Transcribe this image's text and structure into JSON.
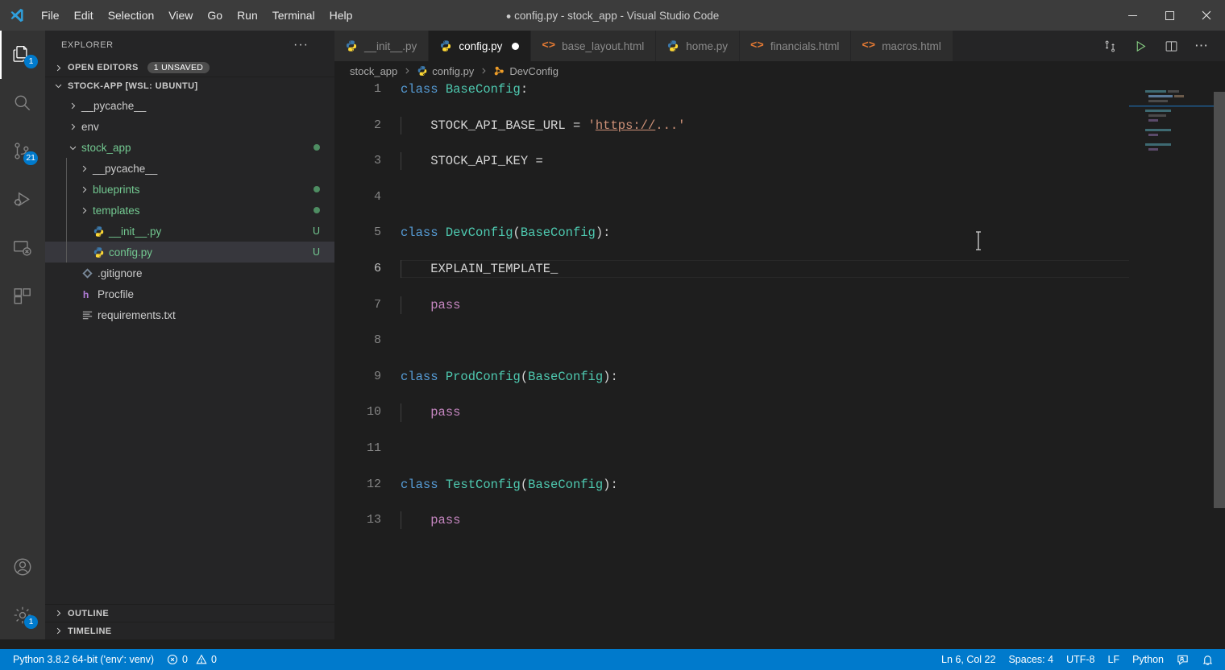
{
  "titlebar": {
    "menus": [
      "File",
      "Edit",
      "Selection",
      "View",
      "Go",
      "Run",
      "Terminal",
      "Help"
    ],
    "unsaved_dot": "●",
    "title": "config.py - stock_app - Visual Studio Code",
    "minimize": "─",
    "maximize": "☐",
    "close": "✕",
    "logo_name": "vscode-logo"
  },
  "activitybar": {
    "items": [
      {
        "name": "explorer",
        "icon": "files-icon",
        "badge": "1",
        "active": true
      },
      {
        "name": "search",
        "icon": "search-icon",
        "badge": "",
        "active": false
      },
      {
        "name": "source-control",
        "icon": "source-control-icon",
        "badge": "21",
        "active": false
      },
      {
        "name": "run-and-debug",
        "icon": "run-debug-icon",
        "badge": "",
        "active": false
      },
      {
        "name": "remote-explorer",
        "icon": "remote-icon",
        "badge": "",
        "active": false
      },
      {
        "name": "extensions",
        "icon": "extensions-icon",
        "badge": "",
        "active": false
      }
    ],
    "bottom": [
      {
        "name": "accounts",
        "icon": "account-icon",
        "badge": ""
      },
      {
        "name": "settings",
        "icon": "gear-icon",
        "badge": "1"
      }
    ]
  },
  "sidebar": {
    "title": "EXPLORER",
    "more_actions": "···",
    "open_editors": {
      "label": "OPEN EDITORS",
      "badge": "1 UNSAVED",
      "expanded": false
    },
    "workspace": {
      "label": "STOCK-APP [WSL: UBUNTU]",
      "expanded": true
    },
    "tree": [
      {
        "label": "__pycache__",
        "type": "folder",
        "depth": 1,
        "expanded": false,
        "color": "gray",
        "suffix": "",
        "suffix_type": "",
        "selected": false
      },
      {
        "label": "env",
        "type": "folder",
        "depth": 1,
        "expanded": false,
        "color": "gray",
        "suffix": "",
        "suffix_type": "",
        "selected": false
      },
      {
        "label": "stock_app",
        "type": "folder",
        "depth": 1,
        "expanded": true,
        "color": "green",
        "suffix": "",
        "suffix_type": "dot",
        "selected": false
      },
      {
        "label": "__pycache__",
        "type": "folder",
        "depth": 2,
        "expanded": false,
        "color": "gray",
        "suffix": "",
        "suffix_type": "",
        "selected": false
      },
      {
        "label": "blueprints",
        "type": "folder",
        "depth": 2,
        "expanded": false,
        "color": "green",
        "suffix": "",
        "suffix_type": "dot",
        "selected": false
      },
      {
        "label": "templates",
        "type": "folder",
        "depth": 2,
        "expanded": false,
        "color": "green",
        "suffix": "",
        "suffix_type": "dot",
        "selected": false
      },
      {
        "label": "__init__.py",
        "type": "python",
        "depth": 2,
        "expanded": false,
        "color": "green",
        "suffix": "U",
        "suffix_type": "text",
        "selected": false
      },
      {
        "label": "config.py",
        "type": "python",
        "depth": 2,
        "expanded": false,
        "color": "green",
        "suffix": "U",
        "suffix_type": "text",
        "selected": true
      },
      {
        "label": ".gitignore",
        "type": "git",
        "depth": 1,
        "expanded": false,
        "color": "gray",
        "suffix": "",
        "suffix_type": "",
        "selected": false
      },
      {
        "label": "Procfile",
        "type": "heroku",
        "depth": 1,
        "expanded": false,
        "color": "gray",
        "suffix": "",
        "suffix_type": "",
        "selected": false
      },
      {
        "label": "requirements.txt",
        "type": "text",
        "depth": 1,
        "expanded": false,
        "color": "gray",
        "suffix": "",
        "suffix_type": "",
        "selected": false
      }
    ],
    "outline": {
      "label": "OUTLINE",
      "expanded": false
    },
    "timeline": {
      "label": "TIMELINE",
      "expanded": false
    }
  },
  "tabs": [
    {
      "label": "__init__.py",
      "icon": "python-icon",
      "active": false,
      "dirty": false
    },
    {
      "label": "config.py",
      "icon": "python-icon",
      "active": true,
      "dirty": true
    },
    {
      "label": "base_layout.html",
      "icon": "html-icon",
      "active": false,
      "dirty": false
    },
    {
      "label": "home.py",
      "icon": "python-icon",
      "active": false,
      "dirty": false
    },
    {
      "label": "financials.html",
      "icon": "html-icon",
      "active": false,
      "dirty": false
    },
    {
      "label": "macros.html",
      "icon": "html-icon",
      "active": false,
      "dirty": false
    }
  ],
  "tab_actions": [
    {
      "name": "open-changes-icon",
      "label": ""
    },
    {
      "name": "run-python-file-icon",
      "label": ""
    },
    {
      "name": "split-editor-icon",
      "label": ""
    },
    {
      "name": "more-actions-icon",
      "label": "···"
    }
  ],
  "breadcrumbs": [
    {
      "label": "stock_app",
      "icon": ""
    },
    {
      "label": "config.py",
      "icon": "python-icon"
    },
    {
      "label": "DevConfig",
      "icon": "class-icon"
    }
  ],
  "editor": {
    "filename": "config.py",
    "language": "Python",
    "lines": [
      {
        "n": "1",
        "current": false,
        "indent": 0,
        "tokens": [
          {
            "t": "class ",
            "c": "kw"
          },
          {
            "t": "BaseConfig",
            "c": "cls"
          },
          {
            "t": ":",
            "c": "op"
          }
        ]
      },
      {
        "n": "2",
        "current": false,
        "indent": 1,
        "tokens": [
          {
            "t": "    STOCK_API_BASE_URL ",
            "c": "ident"
          },
          {
            "t": "= ",
            "c": "op"
          },
          {
            "t": "'",
            "c": "str"
          },
          {
            "t": "https://",
            "c": "link"
          },
          {
            "t": "...'",
            "c": "str"
          }
        ]
      },
      {
        "n": "3",
        "current": false,
        "indent": 1,
        "tokens": [
          {
            "t": "    STOCK_API_KEY ",
            "c": "ident"
          },
          {
            "t": "=",
            "c": "op"
          }
        ]
      },
      {
        "n": "4",
        "current": false,
        "indent": 0,
        "tokens": []
      },
      {
        "n": "5",
        "current": false,
        "indent": 0,
        "tokens": [
          {
            "t": "class ",
            "c": "kw"
          },
          {
            "t": "DevConfig",
            "c": "cls"
          },
          {
            "t": "(",
            "c": "op"
          },
          {
            "t": "BaseConfig",
            "c": "cls"
          },
          {
            "t": "):",
            "c": "op"
          }
        ]
      },
      {
        "n": "6",
        "current": true,
        "indent": 1,
        "tokens": [
          {
            "t": "    EXPLAIN_TEMPLATE_",
            "c": "ident"
          }
        ]
      },
      {
        "n": "7",
        "current": false,
        "indent": 1,
        "tokens": [
          {
            "t": "    ",
            "c": "ident"
          },
          {
            "t": "pass",
            "c": "kw2"
          }
        ]
      },
      {
        "n": "8",
        "current": false,
        "indent": 0,
        "tokens": []
      },
      {
        "n": "9",
        "current": false,
        "indent": 0,
        "tokens": [
          {
            "t": "class ",
            "c": "kw"
          },
          {
            "t": "ProdConfig",
            "c": "cls"
          },
          {
            "t": "(",
            "c": "op"
          },
          {
            "t": "BaseConfig",
            "c": "cls"
          },
          {
            "t": "):",
            "c": "op"
          }
        ]
      },
      {
        "n": "10",
        "current": false,
        "indent": 1,
        "tokens": [
          {
            "t": "    ",
            "c": "ident"
          },
          {
            "t": "pass",
            "c": "kw2"
          }
        ]
      },
      {
        "n": "11",
        "current": false,
        "indent": 0,
        "tokens": []
      },
      {
        "n": "12",
        "current": false,
        "indent": 0,
        "tokens": [
          {
            "t": "class ",
            "c": "kw"
          },
          {
            "t": "TestConfig",
            "c": "cls"
          },
          {
            "t": "(",
            "c": "op"
          },
          {
            "t": "BaseConfig",
            "c": "cls"
          },
          {
            "t": "):",
            "c": "op"
          }
        ]
      },
      {
        "n": "13",
        "current": false,
        "indent": 1,
        "tokens": [
          {
            "t": "    ",
            "c": "ident"
          },
          {
            "t": "pass",
            "c": "kw2"
          }
        ]
      }
    ]
  },
  "statusbar": {
    "left": [
      {
        "name": "python-interpreter",
        "label": "Python 3.8.2 64-bit ('env': venv)",
        "icon": ""
      },
      {
        "name": "problems",
        "label": "0",
        "icon": "error-icon",
        "label2": "0",
        "icon2": "warning-icon"
      }
    ],
    "right": [
      {
        "name": "editor-position",
        "label": "Ln 6, Col 22"
      },
      {
        "name": "indentation",
        "label": "Spaces: 4"
      },
      {
        "name": "encoding",
        "label": "UTF-8"
      },
      {
        "name": "eol",
        "label": "LF"
      },
      {
        "name": "language-mode",
        "label": "Python"
      },
      {
        "name": "feedback-icon",
        "label": ""
      },
      {
        "name": "notifications-bell-icon",
        "label": ""
      }
    ],
    "background": "#007acc"
  },
  "colors": {
    "accent": "#007acc",
    "editor_bg": "#1e1e1e",
    "sidebar_bg": "#252526",
    "activitybar_bg": "#333333",
    "titlebar_bg": "#3c3c3c",
    "git_modified": "#73c991",
    "keyword": "#569cd6",
    "class_name": "#4ec9b0",
    "string": "#ce9178",
    "control_keyword": "#c586c0"
  }
}
